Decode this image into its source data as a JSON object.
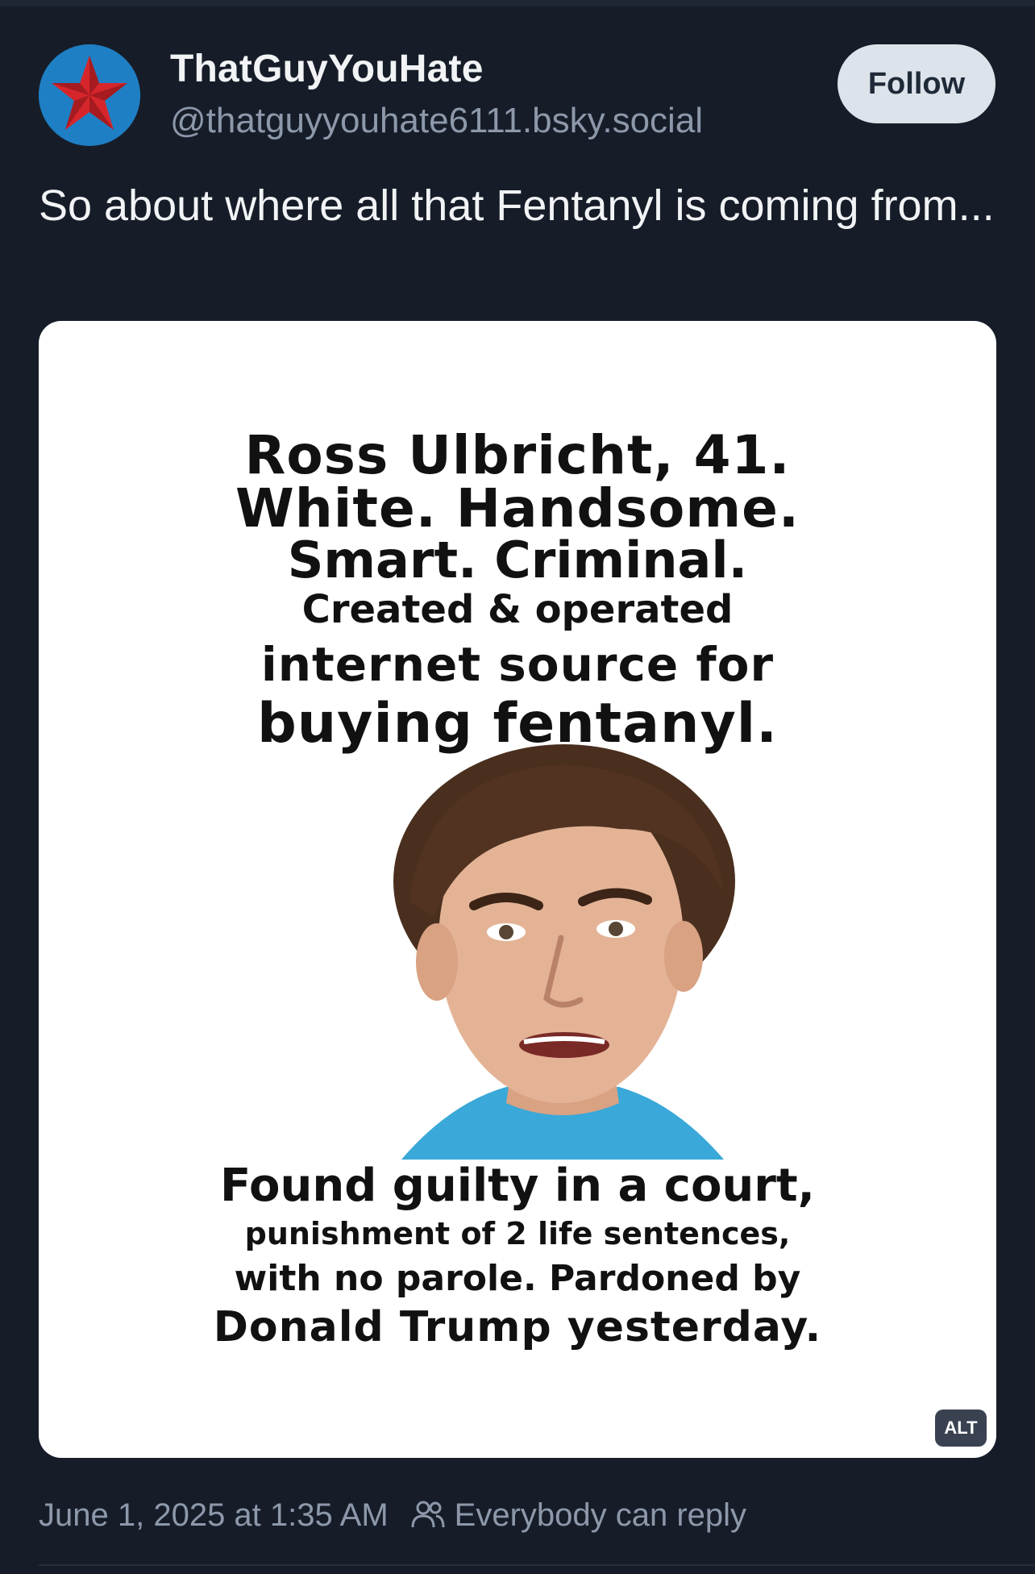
{
  "post": {
    "author": {
      "display_name": "ThatGuyYouHate",
      "handle": "@thatguyyouhate6111.bsky.social",
      "avatar_icon": "red-star-avatar"
    },
    "follow_label": "Follow",
    "text": "So about where all that Fentanyl is coming from...",
    "image": {
      "alt_badge": "ALT",
      "top_lines": [
        "Ross Ulbricht, 41.",
        "White. Handsome.",
        "Smart. Criminal.",
        "Created & operated",
        "internet source for",
        "buying fentanyl."
      ],
      "bottom_lines": [
        "Found guilty in a court,",
        "punishment of 2 life sentences,",
        "with no parole. Pardoned by",
        "Donald Trump yesterday."
      ]
    },
    "timestamp": "June 1, 2025 at 1:35 AM",
    "reply_setting": "Everybody can reply",
    "reply_icon": "people-icon"
  },
  "colors": {
    "background": "#161d29",
    "text_primary": "#f1f3f5",
    "text_secondary": "#8d98aa",
    "follow_button": "#dde3ea"
  }
}
